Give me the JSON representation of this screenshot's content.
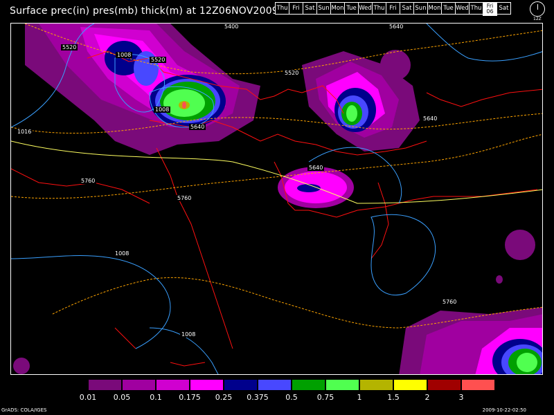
{
  "title": "Surface prec(in) pres(mb) thick(m) at 12Z06NOV2009",
  "days": [
    "Thu",
    "Fri",
    "Sat",
    "Sun",
    "Mon",
    "Tue",
    "Wed",
    "Thu",
    "Fri",
    "Sat",
    "Sun",
    "Mon",
    "Tue",
    "Wed",
    "Thu"
  ],
  "active_day": {
    "name": "Fri",
    "date": "06"
  },
  "last_day": "Sat",
  "clock_label": "12Z",
  "contour_labels": {
    "thick_5400": "5400",
    "thick_5520_a": "5520",
    "thick_5520_b": "5520",
    "thick_5520_c": "5520",
    "thick_5640_a": "5640",
    "thick_5640_b": "5640",
    "thick_5640_c": "5640",
    "thick_5640_d": "5640",
    "thick_5760_a": "5760",
    "thick_5760_b": "5760",
    "thick_5760_c": "5760",
    "pres_1008_a": "1008",
    "pres_1008_b": "1008",
    "pres_1008_c": "1008",
    "pres_1008_d": "1008",
    "pres_1016": "1016"
  },
  "legend": {
    "colors": [
      "#000000",
      "#7a0a7a",
      "#a000a0",
      "#d000d0",
      "#ff00ff",
      "#00008c",
      "#4848ff",
      "#00a000",
      "#50ff50",
      "#b4b400",
      "#ffff00",
      "#a00000",
      "#ff5050"
    ],
    "labels": [
      "0.01",
      "0.05",
      "0.1",
      "0.175",
      "0.25",
      "0.375",
      "0.5",
      "0.75",
      "1",
      "1.5",
      "2",
      "3"
    ]
  },
  "footer": {
    "left": "GrADS: COLA/IGES",
    "right": "2009-10-22-02:50"
  }
}
